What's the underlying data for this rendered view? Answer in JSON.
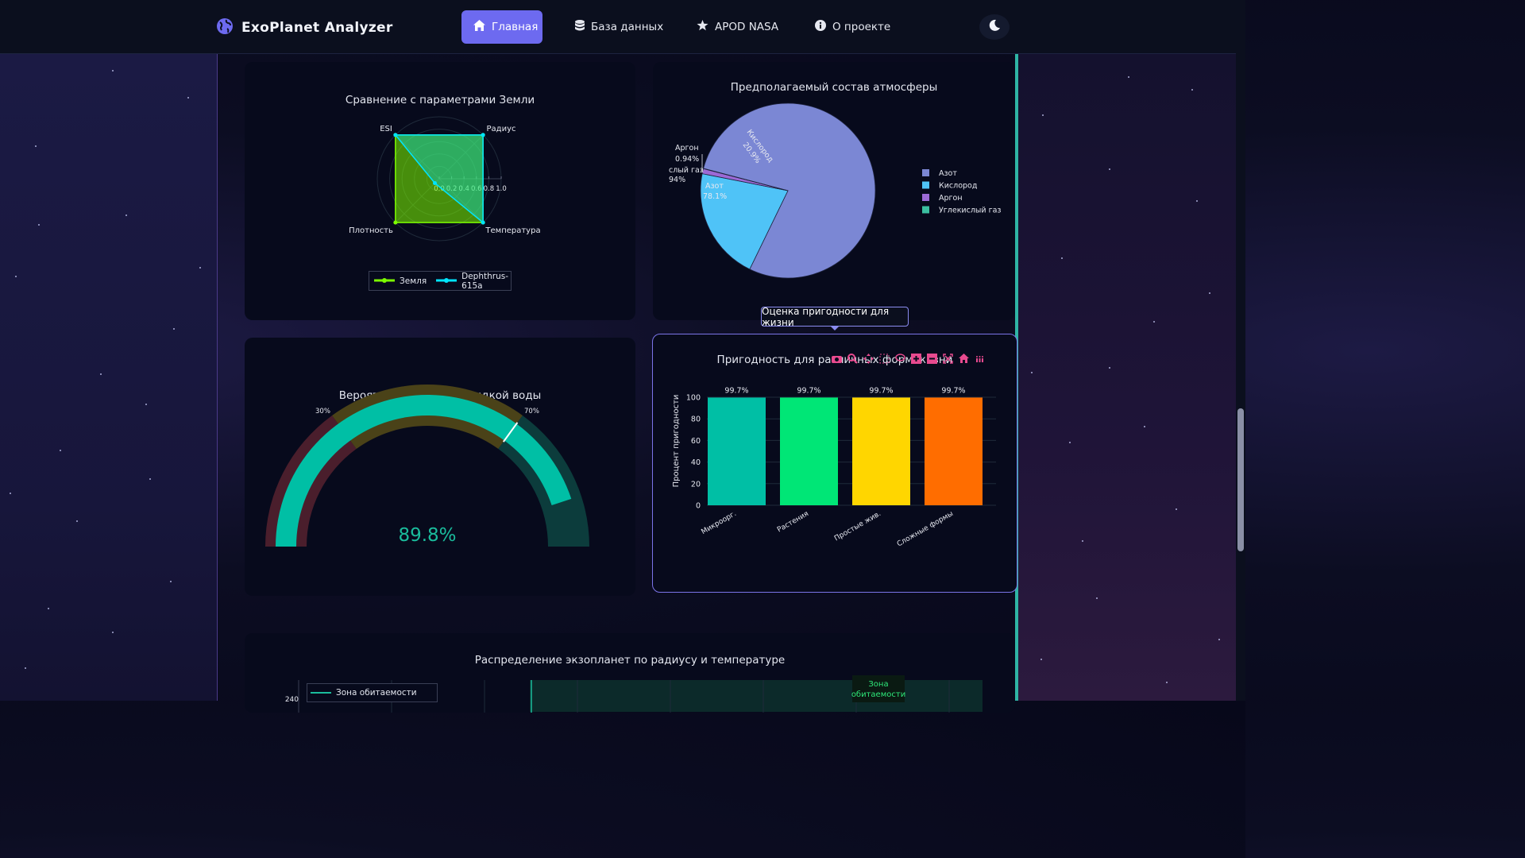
{
  "app": {
    "title": "ExoPlanet Analyzer"
  },
  "nav": {
    "items": [
      {
        "label": "Главная",
        "icon": "home-icon",
        "active": true
      },
      {
        "label": "База данных",
        "icon": "database-icon",
        "active": false
      },
      {
        "label": "APOD NASA",
        "icon": "star-icon",
        "active": false
      },
      {
        "label": "О проекте",
        "icon": "info-icon",
        "active": false
      }
    ],
    "theme_toggle_icon": "moon-icon"
  },
  "colors": {
    "accent": "#6d6af0",
    "teal": "#1abc9c",
    "green": "#7cfc00",
    "cyan": "#00e5ff"
  },
  "radar": {
    "title": "Сравнение с параметрами Земли",
    "axes": [
      "ESI",
      "Радиус",
      "Температура",
      "Плотность"
    ],
    "ticks": [
      "0.0",
      "0.2",
      "0.4",
      "0.6",
      "0.8",
      "1.0"
    ],
    "legend": [
      "Земля",
      "Dephthrus-615a"
    ]
  },
  "pie": {
    "title": "Предполагаемый состав атмосферы",
    "labels": {
      "argon_name": "Аргон",
      "argon_pct": "0.94%",
      "co2_name": "слый газ",
      "co2_pct": "94%",
      "nitrogen_name": "Азот",
      "nitrogen_pct": "78.1%",
      "oxygen_name": "Кислород",
      "oxygen_pct": "20.9%"
    },
    "legend": [
      "Азот",
      "Кислород",
      "Аргон",
      "Углекислый газ"
    ]
  },
  "gauge": {
    "title": "Вероятность наличия жидкой воды",
    "value_text": "89.8%",
    "tick_30": "30%",
    "tick_70": "70%"
  },
  "tooltip": {
    "text": "Оценка пригодности для жизни"
  },
  "bar": {
    "title": "Пригодность для различных форм жизни",
    "ylabel": "Процент пригодности",
    "yticks": [
      "0",
      "20",
      "40",
      "60",
      "80",
      "100"
    ],
    "value_labels": [
      "99.7%",
      "99.7%",
      "99.7%",
      "99.7%"
    ]
  },
  "bottom": {
    "title": "Распределение экзопланет по радиусу и температуре",
    "legend_label": "Зона обитаемости",
    "zone_label_1": "Зона",
    "zone_label_2": "обитаемости",
    "y_tick": "240"
  },
  "chart_data": [
    {
      "type": "radar",
      "title": "Сравнение с параметрами Земли",
      "axes": [
        "ESI",
        "Радиус",
        "Температура",
        "Плотность"
      ],
      "range": [
        0,
        1
      ],
      "series": [
        {
          "name": "Земля",
          "values": [
            1.0,
            1.0,
            1.0,
            1.0
          ]
        },
        {
          "name": "Dephthrus-615a",
          "values": [
            1.0,
            1.0,
            1.0,
            0.1
          ]
        }
      ]
    },
    {
      "type": "pie",
      "title": "Предполагаемый состав атмосферы",
      "categories": [
        "Азот",
        "Кислород",
        "Аргон",
        "Углекислый газ"
      ],
      "values": [
        78.1,
        20.9,
        0.94,
        0.04
      ],
      "colors": [
        "#7b87d4",
        "#4fc3f7",
        "#9c6ad6",
        "#3bbfa0"
      ]
    },
    {
      "type": "gauge",
      "title": "Вероятность наличия жидкой воды",
      "value": 89.8,
      "range": [
        0,
        100
      ],
      "threshold": 70
    },
    {
      "type": "bar",
      "title": "Пригодность для различных форм жизни",
      "categories": [
        "Микроорг.",
        "Растения",
        "Простые жив.",
        "Сложные формы"
      ],
      "values": [
        99.7,
        99.7,
        99.7,
        99.7
      ],
      "colors": [
        "#00bfa5",
        "#00e676",
        "#ffd600",
        "#ff6d00"
      ],
      "ylabel": "Процент пригодности",
      "ylim": [
        0,
        100
      ]
    }
  ]
}
